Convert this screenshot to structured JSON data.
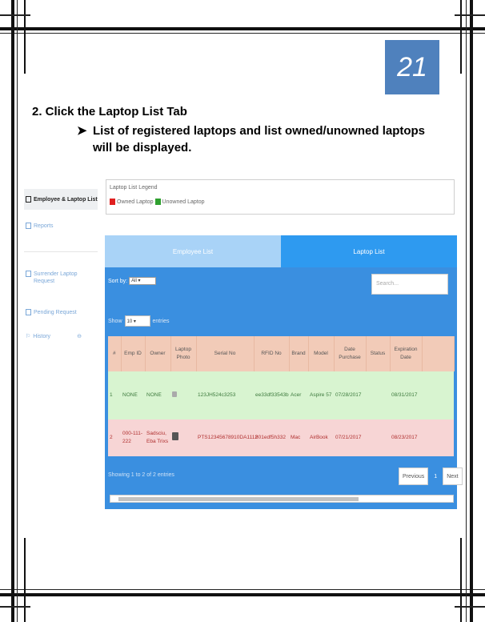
{
  "page_number": "21",
  "step": {
    "heading": "2.  Click the Laptop List Tab",
    "bullet_arrow": "➤",
    "bullet_line1": "List of registered laptops and list owned/unowned laptops",
    "bullet_line2": "will be displayed."
  },
  "sidebar": {
    "items": [
      {
        "label": "Employee & Laptop List"
      },
      {
        "label": "Reports"
      },
      {
        "label": "Surrender Laptop Request"
      },
      {
        "label": "Pending Request"
      },
      {
        "label": "History"
      }
    ]
  },
  "legend": {
    "title": "Laptop List Legend",
    "owned": "Owned Laptop",
    "unowned": "Unowned Laptop",
    "owned_color": "#e02020",
    "unowned_color": "#2fa02f"
  },
  "tabs": {
    "employee": "Employee List",
    "laptop": "Laptop List"
  },
  "controls": {
    "sort_by": "Sort by:",
    "sort_value": "All",
    "search_placeholder": "Search...",
    "show": "Show",
    "show_value": "10",
    "entries": "entries"
  },
  "table": {
    "headers": [
      "#",
      "Emp ID",
      "Owner",
      "Laptop Photo",
      "Serial No",
      "RFID No",
      "Brand",
      "Model",
      "Date Purchase",
      "Status",
      "Expiration Date"
    ],
    "rows": [
      {
        "num": "1",
        "emp_id": "NONE",
        "owner": "NONE",
        "serial": "123JH524c3253",
        "rfid": "ee33df33543b",
        "brand": "Acer",
        "model": "Aspire 57",
        "date": "07/28/2017",
        "status": "",
        "expiry": "08/31/2017"
      },
      {
        "num": "2",
        "emp_id": "000-111-222",
        "owner": "Sadsciu, Eba Trixs",
        "serial": "PTS12345678910DA1112",
        "rfid": "801edf5h332",
        "brand": "Mac",
        "model": "AirBook",
        "date": "07/21/2017",
        "status": "",
        "expiry": "08/23/2017"
      }
    ]
  },
  "footer": {
    "showing": "Showing 1 to 2 of 2 entries",
    "previous": "Previous",
    "current_page": "1",
    "next": "Next"
  }
}
